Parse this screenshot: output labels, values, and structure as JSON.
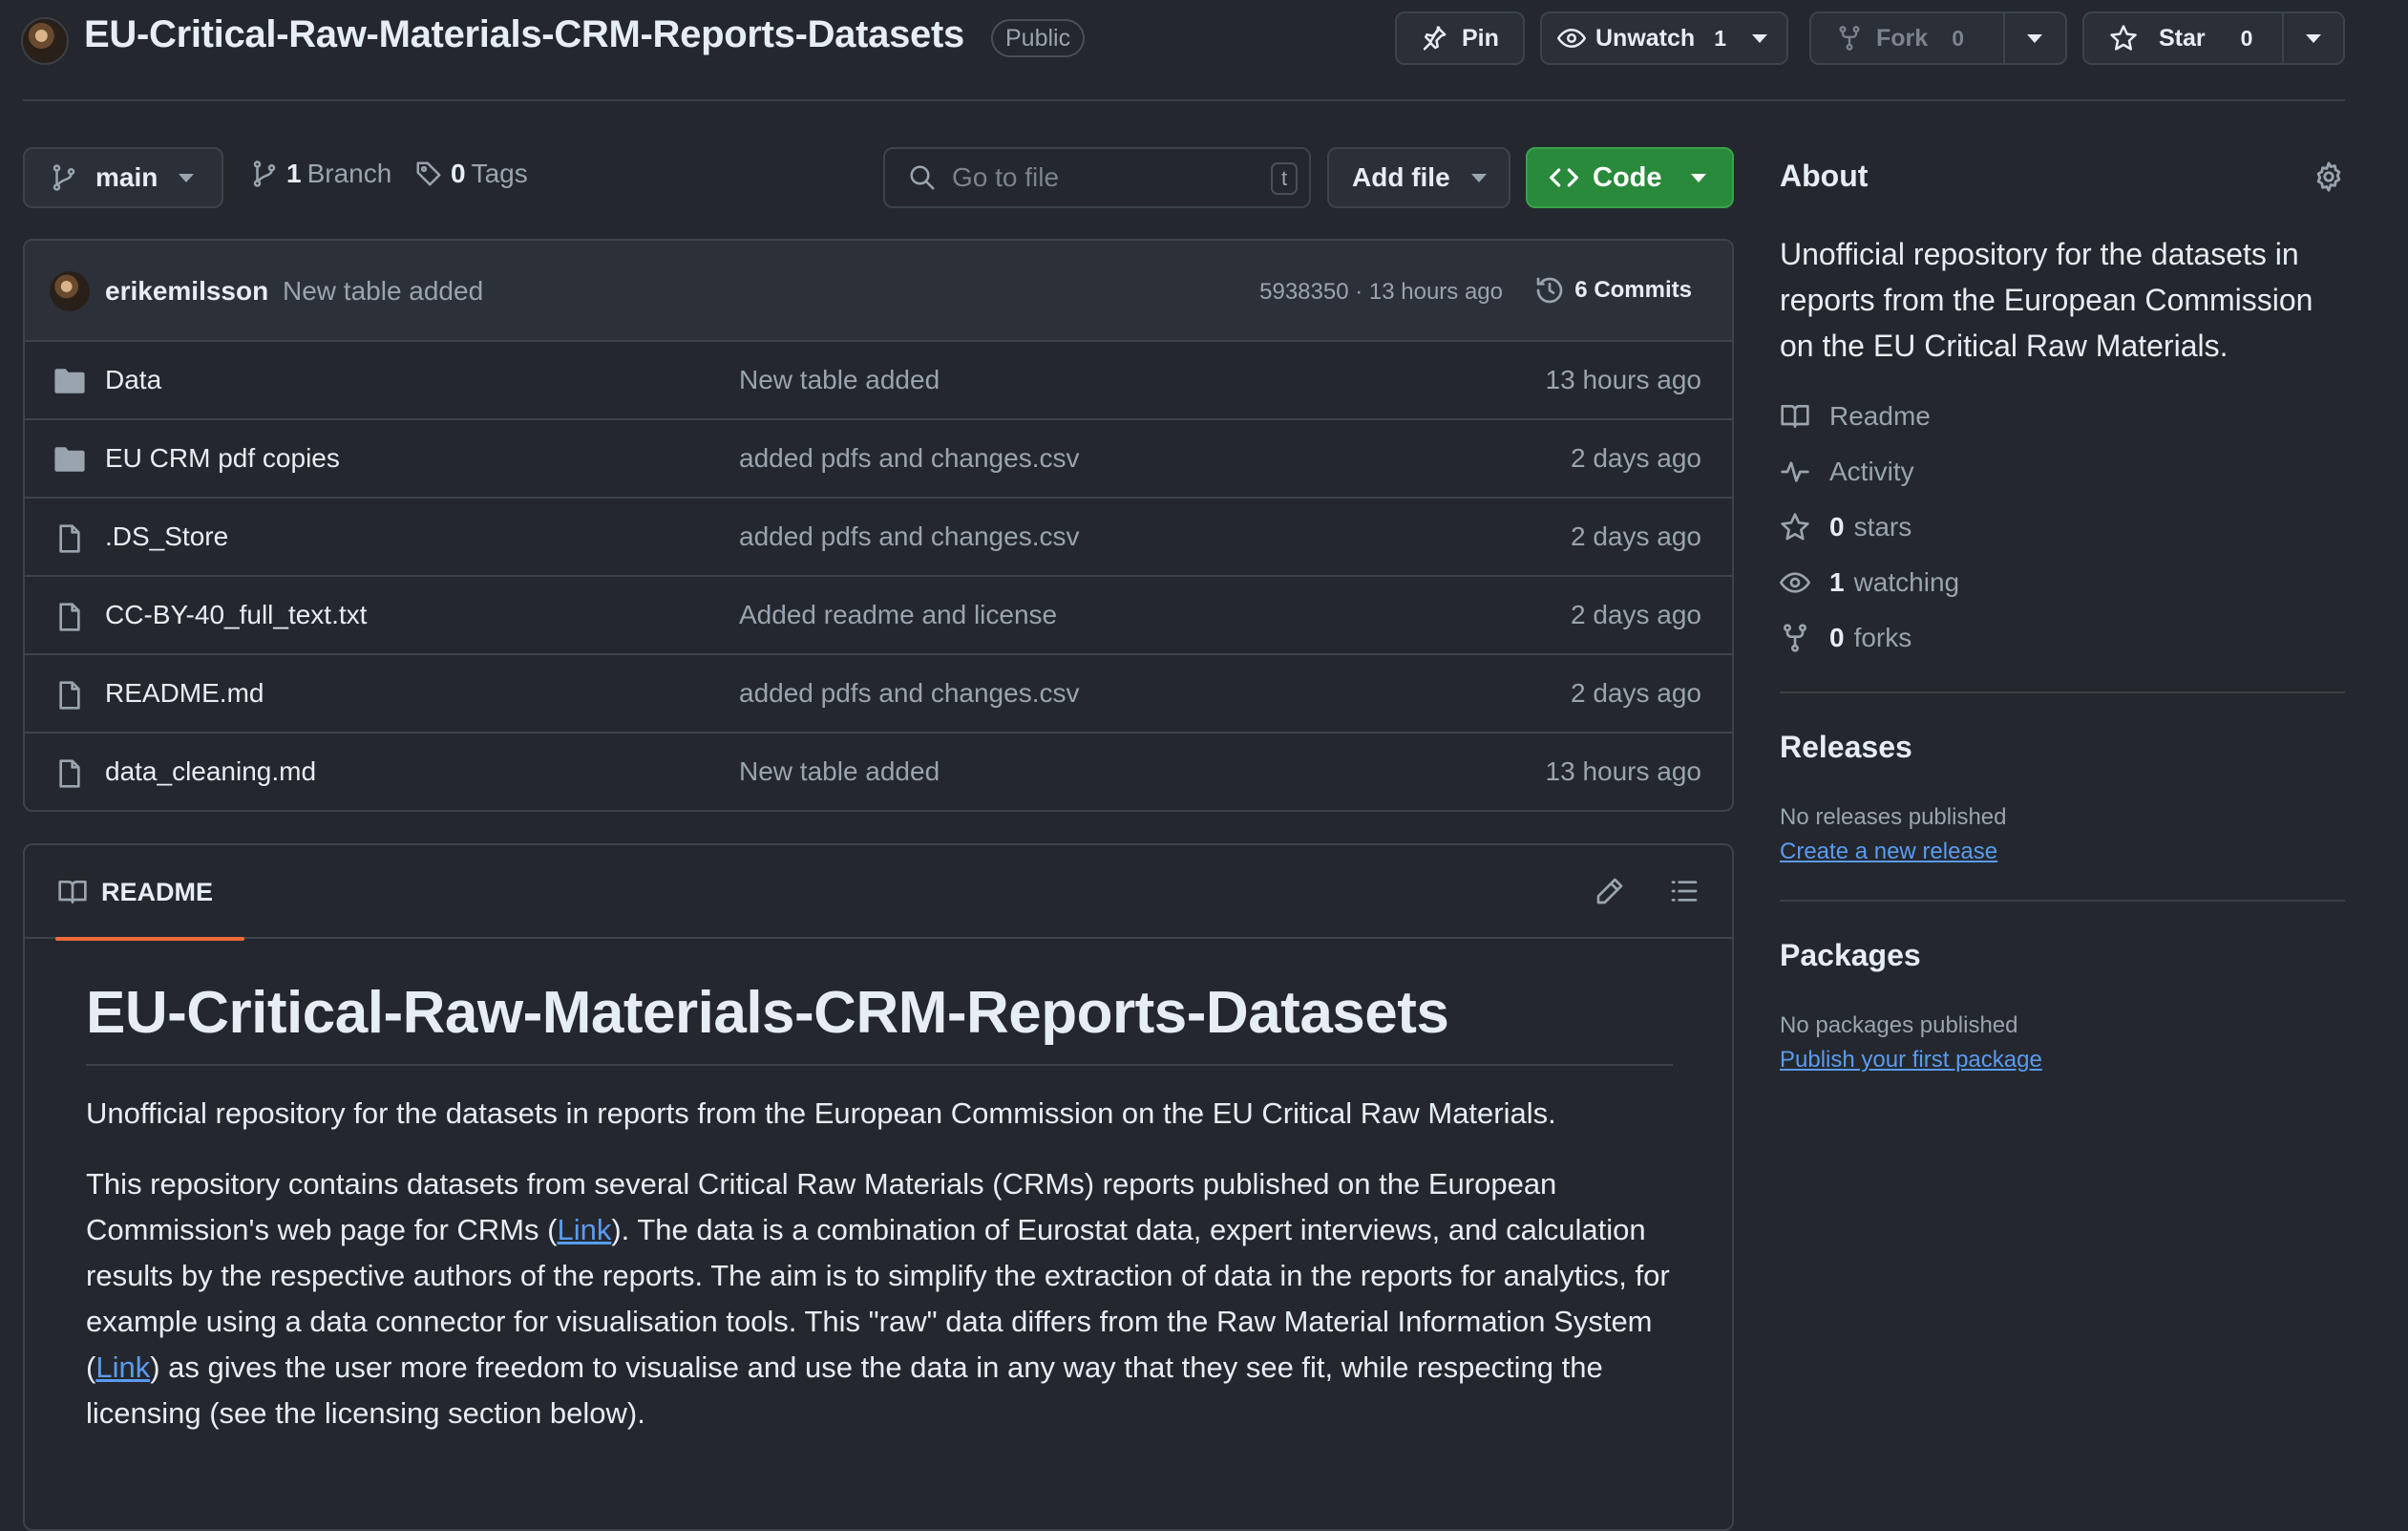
{
  "repo": {
    "name": "EU-Critical-Raw-Materials-CRM-Reports-Datasets",
    "visibility": "Public"
  },
  "header_actions": {
    "pin_label": "Pin",
    "unwatch_label": "Unwatch",
    "watch_count": "1",
    "fork_label": "Fork",
    "fork_count": "0",
    "star_label": "Star",
    "star_count": "0"
  },
  "toolbar": {
    "branch": "main",
    "branch_count": "1",
    "branch_label": "Branch",
    "tag_count": "0",
    "tag_label": "Tags",
    "search_placeholder": "Go to file",
    "search_shortcut": "t",
    "add_file_label": "Add file",
    "code_label": "Code"
  },
  "latest_commit": {
    "author": "erikemilsson",
    "message": "New table added",
    "meta": "5938350 · 13 hours ago",
    "commits_label": "6 Commits"
  },
  "files": [
    {
      "type": "folder",
      "name": "Data",
      "commit": "New table added",
      "time": "13 hours ago"
    },
    {
      "type": "folder",
      "name": "EU CRM pdf copies",
      "commit": "added pdfs and changes.csv",
      "time": "2 days ago"
    },
    {
      "type": "file",
      "name": ".DS_Store",
      "commit": "added pdfs and changes.csv",
      "time": "2 days ago"
    },
    {
      "type": "file",
      "name": "CC-BY-40_full_text.txt",
      "commit": "Added readme and license",
      "time": "2 days ago"
    },
    {
      "type": "file",
      "name": "README.md",
      "commit": "added pdfs and changes.csv",
      "time": "2 days ago"
    },
    {
      "type": "file",
      "name": "data_cleaning.md",
      "commit": "New table added",
      "time": "13 hours ago"
    }
  ],
  "readme": {
    "tab_label": "README",
    "title": "EU-Critical-Raw-Materials-CRM-Reports-Datasets",
    "intro": "Unofficial repository for the datasets in reports from the European Commission on the EU Critical Raw Materials.",
    "p2_a": "This repository contains datasets from several Critical Raw Materials (CRMs) reports published on the European Commission's web page for CRMs (",
    "p2_link1": "Link",
    "p2_b": "). The data is a combination of Eurostat data, expert interviews, and calculation results by the respective authors of the reports. The aim is to simplify the extraction of data in the reports for analytics, for example using a data connector for visualisation tools. This \"raw\" data differs from the Raw Material Information System (",
    "p2_link2": "Link",
    "p2_c": ") as gives the user more freedom to visualise and use the data in any way that they see fit, while respecting the licensing (see the licensing section below)."
  },
  "about": {
    "title": "About",
    "description": "Unofficial repository for the datasets in reports from the European Commission on the EU Critical Raw Materials.",
    "readme_label": "Readme",
    "activity_label": "Activity",
    "stars_count": "0",
    "stars_label": "stars",
    "watching_count": "1",
    "watching_label": "watching",
    "forks_count": "0",
    "forks_label": "forks"
  },
  "releases": {
    "title": "Releases",
    "empty_text": "No releases published",
    "create_link": "Create a new release"
  },
  "packages": {
    "title": "Packages",
    "empty_text": "No packages published",
    "publish_link": "Publish your first package"
  },
  "icons": {
    "folder": "folder-icon",
    "file": "file-icon",
    "colors": {
      "accent_green": "#2a8a3c",
      "link_blue": "#5a9bf0",
      "tab_underline": "#f26b3a"
    }
  }
}
